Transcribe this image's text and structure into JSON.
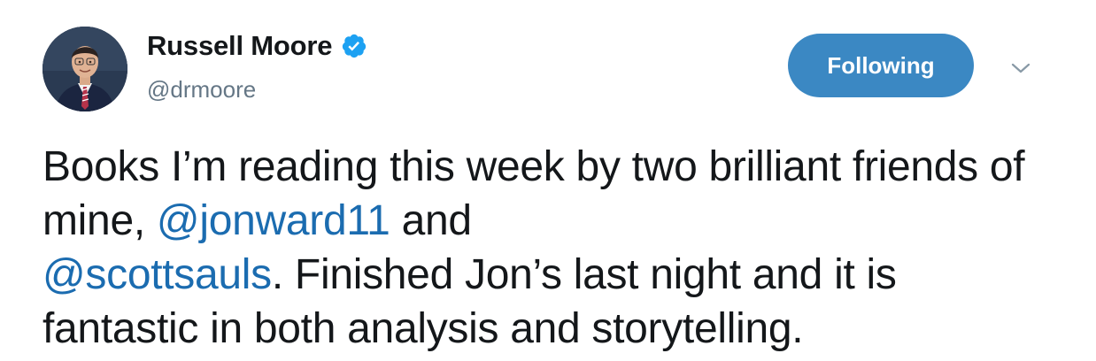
{
  "author": {
    "display_name": "Russell Moore",
    "handle": "@drmoore",
    "verified_icon": "verified-badge-icon",
    "avatar": "profile-photo"
  },
  "actions": {
    "follow_label": "Following",
    "caret_icon": "chevron-down-icon"
  },
  "tweet": {
    "segments": [
      {
        "text": "Books I’m reading this week by two brilliant friends of mine, ",
        "type": "text"
      },
      {
        "text": "@jonward11",
        "type": "mention"
      },
      {
        "text": " and ",
        "type": "text"
      },
      {
        "text": "@scottsauls",
        "type": "mention"
      },
      {
        "text": ". Finished Jon’s last night and it is fantastic in both analysis and storytelling.",
        "type": "text"
      }
    ]
  },
  "colors": {
    "button_bg": "#3b88c3",
    "mention": "#1b6cb0",
    "handle": "#657786",
    "verified": "#1da1f2"
  }
}
